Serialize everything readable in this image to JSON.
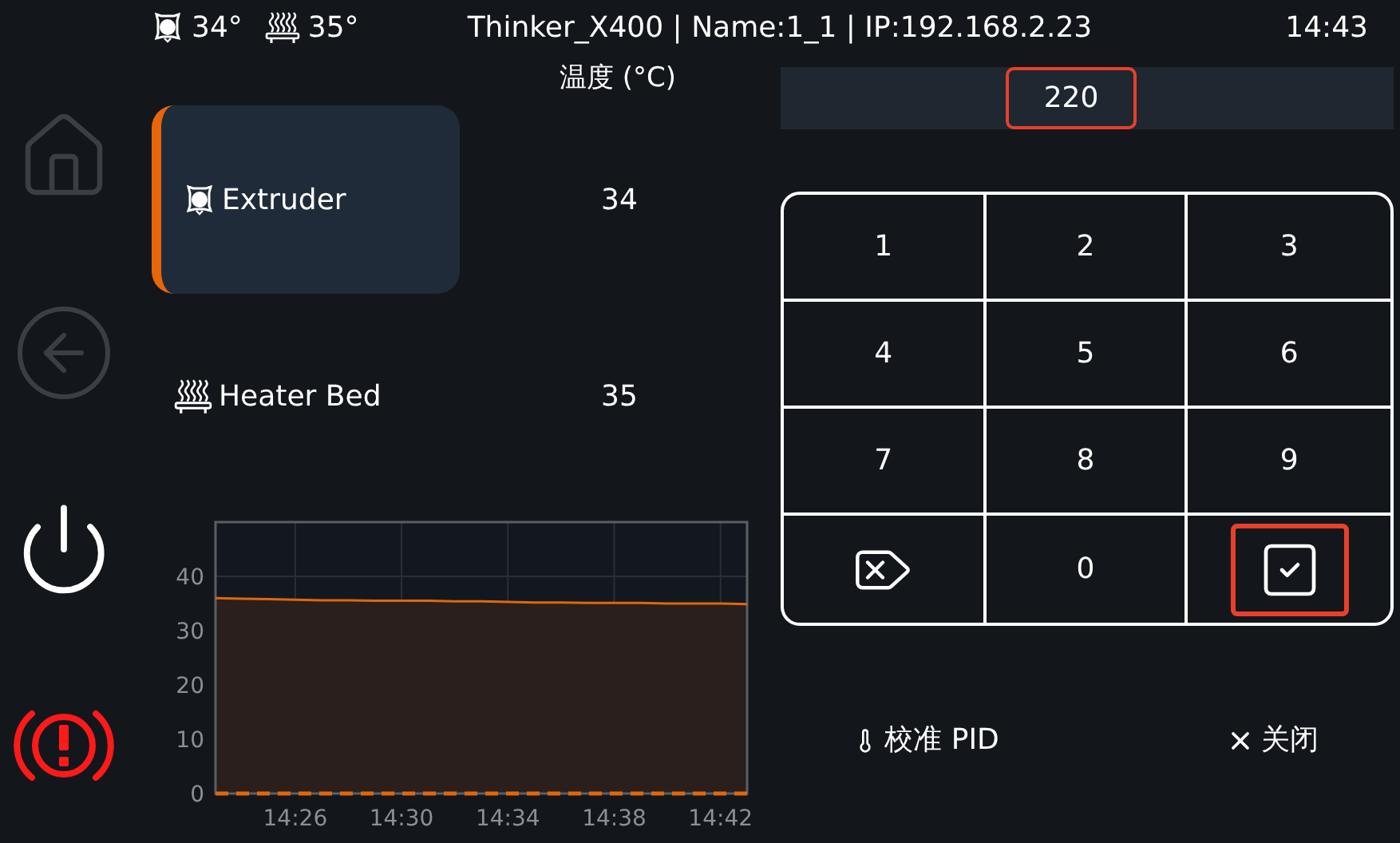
{
  "top_bar": {
    "extruder_temp": "34°",
    "bed_temp": "35°",
    "title": "Thinker_X400 | Name:1_1 | IP:192.168.2.23",
    "time": "14:43"
  },
  "sidebar": {
    "items": [
      {
        "kind": "home",
        "disabled": true
      },
      {
        "kind": "back",
        "disabled": true
      },
      {
        "kind": "power",
        "disabled": false
      },
      {
        "kind": "emergency",
        "disabled": false
      }
    ]
  },
  "heaters": {
    "header": "温度 (°C)",
    "items": [
      {
        "kind": "extruder",
        "name": "Extruder",
        "value": "34",
        "selected": true
      },
      {
        "kind": "bed",
        "name": "Heater Bed",
        "value": "35",
        "selected": false
      }
    ]
  },
  "chart_data": {
    "type": "line",
    "categories": [
      null,
      null,
      null,
      "14:26",
      null,
      null,
      null,
      "14:30",
      null,
      null,
      null,
      "14:34",
      null,
      null,
      null,
      "14:38",
      null,
      null,
      null,
      "14:42",
      null
    ],
    "ylim": [
      0,
      50
    ],
    "yticks": [
      0,
      10,
      20,
      30,
      40
    ],
    "grid": true,
    "series": [
      {
        "color": "#e0670c",
        "line_style": "solid",
        "values": [
          36,
          35.9,
          35.8,
          35.7,
          35.6,
          35.6,
          35.5,
          35.5,
          35.5,
          35.4,
          35.4,
          35.3,
          35.2,
          35.2,
          35.1,
          35.1,
          35.1,
          35,
          35,
          35,
          34.9
        ]
      },
      {
        "color": "#e0670c",
        "line_style": "dashed",
        "values": [
          0,
          0,
          0,
          0,
          0,
          0,
          0,
          0,
          0,
          0,
          0,
          0,
          0,
          0,
          0,
          0,
          0,
          0,
          0,
          0,
          0
        ]
      }
    ]
  },
  "input": {
    "value": "220",
    "highlighted": true
  },
  "keypad": {
    "keys": [
      {
        "kind": "digit",
        "label": "1"
      },
      {
        "kind": "digit",
        "label": "2"
      },
      {
        "kind": "digit",
        "label": "3"
      },
      {
        "kind": "digit",
        "label": "4"
      },
      {
        "kind": "digit",
        "label": "5"
      },
      {
        "kind": "digit",
        "label": "6"
      },
      {
        "kind": "digit",
        "label": "7"
      },
      {
        "kind": "digit",
        "label": "8"
      },
      {
        "kind": "digit",
        "label": "9"
      },
      {
        "kind": "backspace",
        "highlighted": false
      },
      {
        "kind": "digit",
        "label": "0"
      },
      {
        "kind": "confirm",
        "highlighted": true
      }
    ]
  },
  "actions": [
    {
      "kind": "pid",
      "label": "校准 PID"
    },
    {
      "kind": "close",
      "label": "关闭"
    }
  ]
}
